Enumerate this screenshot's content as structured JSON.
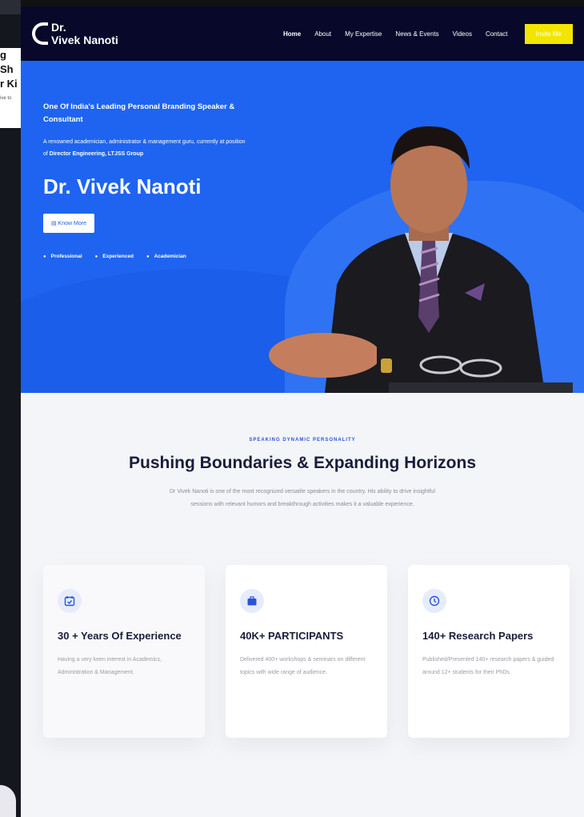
{
  "background_window": {
    "frag1": "g Sh",
    "frag2": "r Ki",
    "frag3": "ive to"
  },
  "logo": {
    "line1": "Dr.",
    "line2": "Vivek Nanoti"
  },
  "nav": {
    "items": [
      "Home",
      "About",
      "My Expertise",
      "News & Events",
      "Videos",
      "Contact"
    ],
    "invite_label": "Invite Me"
  },
  "hero": {
    "tagline": "One Of India's Leading Personal Branding Speaker & Consultant",
    "desc_prefix": "A renowned academician, administrator & management guru, currently at position of ",
    "desc_bold": "Director Engineering, LTJSS Group",
    "name": "Dr. Vivek Nanoti",
    "cta_label": "Know More",
    "traits": [
      "Professional",
      "Experienced",
      "Academician"
    ]
  },
  "intro": {
    "eyebrow": "SPEAKING DYNAMIC PERSONALITY",
    "headline": "Pushing Boundaries & Expanding Horizons",
    "body": "Dr Vivek Nanoti is one of the most recognized versatile speakers in the country. His ability to drive insightful sessions with relevant humors and breakthrough activities makes it a valuable experience."
  },
  "cards": [
    {
      "icon": "calendar-check-icon",
      "title": "30 + Years Of Experience",
      "text": "Having a very keen interest in Academics, Administration & Management."
    },
    {
      "icon": "briefcase-icon",
      "title": "40K+ PARTICIPANTS",
      "text": "Delivered 400+ workshops & seminars on different topics with wide range of audience."
    },
    {
      "icon": "clock-icon",
      "title": "140+ Research Papers",
      "text": "Published/Presented 140+ research papers & guided around 12+ students for their PhDs."
    }
  ],
  "colors": {
    "nav_bg": "#07082a",
    "hero_blue": "#1e64f0",
    "accent_yellow": "#f4e500"
  }
}
